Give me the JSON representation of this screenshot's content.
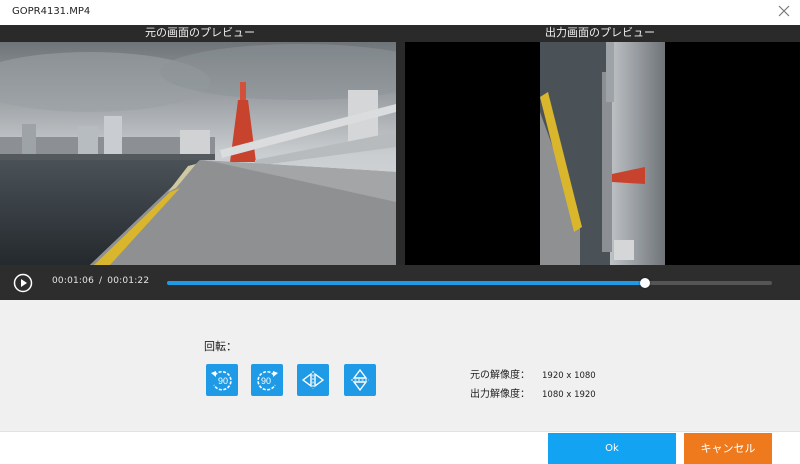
{
  "window": {
    "title": "GOPR4131.MP4"
  },
  "preview": {
    "original_label": "元の画面のプレビュー",
    "output_label": "出力画面のプレビュー"
  },
  "player": {
    "current_time": "00:01:06",
    "separator": "/",
    "total_time": "00:01:22",
    "progress": 0.79
  },
  "settings": {
    "rotation_label": "回転：",
    "rotation_buttons": [
      {
        "icon": "rotate-ccw-90-icon",
        "text": "90"
      },
      {
        "icon": "rotate-cw-90-icon",
        "text": "90"
      },
      {
        "icon": "flip-horizontal-icon"
      },
      {
        "icon": "flip-vertical-icon"
      }
    ],
    "original_resolution_label": "元の解像度：",
    "original_resolution": "1920 x 1080",
    "output_resolution_label": "出力解像度：",
    "output_resolution": "1080 x 1920"
  },
  "footer": {
    "ok_label": "Ok",
    "cancel_label": "キャンセル"
  },
  "colors": {
    "accent": "#1e9ae6",
    "ok_button": "#12a4f2",
    "cancel_button": "#ef7a1d",
    "preview_background": "#2a2a2a"
  }
}
